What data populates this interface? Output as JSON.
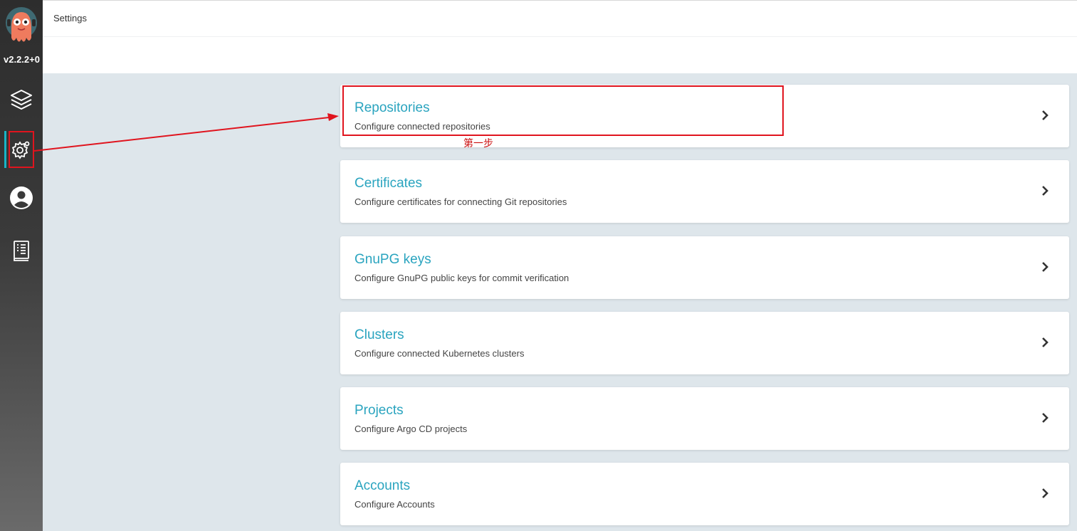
{
  "sidebar": {
    "version": "v2.2.2+0",
    "items": [
      {
        "name": "applications",
        "icon": "layers-icon"
      },
      {
        "name": "settings",
        "icon": "gear-icon"
      },
      {
        "name": "user-info",
        "icon": "user-circle-icon"
      },
      {
        "name": "documentation",
        "icon": "docs-book-icon"
      }
    ]
  },
  "header": {
    "title": "Settings"
  },
  "cards": [
    {
      "title": "Repositories",
      "description": "Configure connected repositories"
    },
    {
      "title": "Certificates",
      "description": "Configure certificates for connecting Git repositories"
    },
    {
      "title": "GnuPG keys",
      "description": "Configure GnuPG public keys for commit verification"
    },
    {
      "title": "Clusters",
      "description": "Configure connected Kubernetes clusters"
    },
    {
      "title": "Projects",
      "description": "Configure Argo CD projects"
    },
    {
      "title": "Accounts",
      "description": "Configure Accounts"
    }
  ],
  "annotation": {
    "step_label": "第一步"
  },
  "colors": {
    "accent": "#2aa4bf",
    "annotation": "#e0141e",
    "sidebar_active": "#18b4c6"
  }
}
